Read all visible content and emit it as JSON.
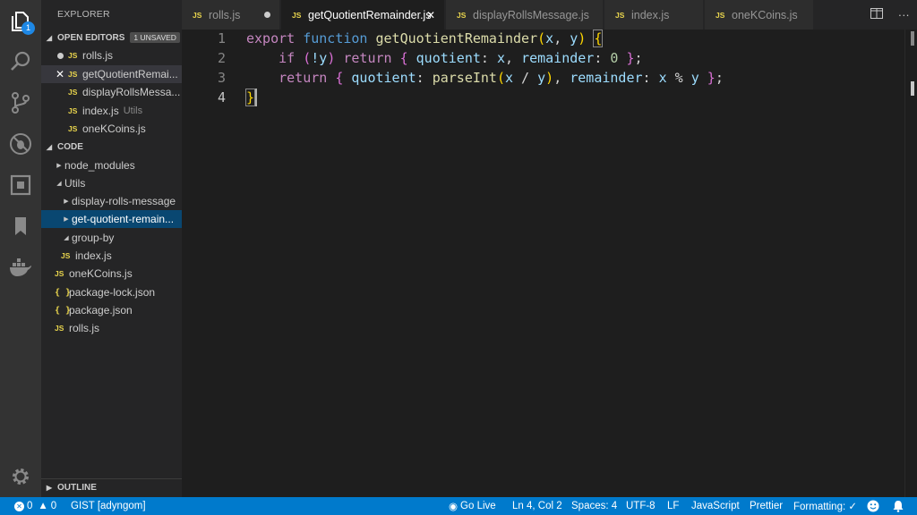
{
  "activity": {
    "badge": "1",
    "icons": [
      "files-icon",
      "search-icon",
      "source-control-icon",
      "debug-icon",
      "extensions-icon",
      "bookmark-icon",
      "docker-icon",
      "gear-icon"
    ]
  },
  "sidebar": {
    "title": "EXPLORER",
    "open_editors": {
      "label": "OPEN EDITORS",
      "badge": "1 UNSAVED",
      "items": [
        {
          "icon": "JS",
          "name": "rolls.js",
          "extra": ""
        },
        {
          "icon": "JS",
          "name": "getQuotientRemai...",
          "extra": ""
        },
        {
          "icon": "JS",
          "name": "displayRollsMessa...",
          "extra": ""
        },
        {
          "icon": "JS",
          "name": "index.js",
          "extra": "Utils"
        },
        {
          "icon": "JS",
          "name": "oneKCoins.js",
          "extra": ""
        }
      ]
    },
    "folder": {
      "label": "CODE",
      "items": [
        {
          "name": "node_modules"
        },
        {
          "name": "Utils"
        },
        {
          "name": "display-rolls-message"
        },
        {
          "name": "get-quotient-remain..."
        },
        {
          "name": "group-by"
        },
        {
          "icon": "JS",
          "name": "index.js"
        },
        {
          "icon": "JS",
          "name": "oneKCoins.js"
        },
        {
          "icon": "{ }",
          "name": "package-lock.json"
        },
        {
          "icon": "{ }",
          "name": "package.json"
        },
        {
          "icon": "JS",
          "name": "rolls.js"
        }
      ]
    },
    "outline": {
      "label": "OUTLINE"
    }
  },
  "tabs": [
    {
      "icon": "JS",
      "label": "rolls.js"
    },
    {
      "icon": "JS",
      "label": "getQuotientRemainder.js"
    },
    {
      "icon": "JS",
      "label": "displayRollsMessage.js"
    },
    {
      "icon": "JS",
      "label": "index.js"
    },
    {
      "icon": "JS",
      "label": "oneKCoins.js"
    }
  ],
  "editor": {
    "line_numbers": [
      "1",
      "2",
      "3",
      "4"
    ],
    "lines": [
      [
        {
          "t": "export",
          "c": "kw"
        },
        {
          "t": " ",
          "c": ""
        },
        {
          "t": "function",
          "c": "kw2"
        },
        {
          "t": " ",
          "c": ""
        },
        {
          "t": "getQuotientRemainder",
          "c": "fn"
        },
        {
          "t": "(",
          "c": "br"
        },
        {
          "t": "x",
          "c": "pm"
        },
        {
          "t": ", ",
          "c": ""
        },
        {
          "t": "y",
          "c": "pm"
        },
        {
          "t": ")",
          "c": "br"
        },
        {
          "t": " ",
          "c": ""
        },
        {
          "t": "{",
          "c": "br bbox"
        }
      ],
      [
        {
          "t": "    ",
          "c": ""
        },
        {
          "t": "if",
          "c": "kw"
        },
        {
          "t": " ",
          "c": ""
        },
        {
          "t": "(",
          "c": "br2"
        },
        {
          "t": "!y",
          "c": "pm"
        },
        {
          "t": ")",
          "c": "br2"
        },
        {
          "t": " ",
          "c": ""
        },
        {
          "t": "return",
          "c": "kw"
        },
        {
          "t": " ",
          "c": ""
        },
        {
          "t": "{",
          "c": "br2"
        },
        {
          "t": " ",
          "c": ""
        },
        {
          "t": "quotient",
          "c": "pm"
        },
        {
          "t": ": ",
          "c": ""
        },
        {
          "t": "x",
          "c": "pm"
        },
        {
          "t": ", ",
          "c": ""
        },
        {
          "t": "remainder",
          "c": "pm"
        },
        {
          "t": ": ",
          "c": ""
        },
        {
          "t": "0",
          "c": "num"
        },
        {
          "t": " ",
          "c": ""
        },
        {
          "t": "}",
          "c": "br2"
        },
        {
          "t": ";",
          "c": ""
        }
      ],
      [
        {
          "t": "    ",
          "c": ""
        },
        {
          "t": "return",
          "c": "kw"
        },
        {
          "t": " ",
          "c": ""
        },
        {
          "t": "{",
          "c": "br2"
        },
        {
          "t": " ",
          "c": ""
        },
        {
          "t": "quotient",
          "c": "pm"
        },
        {
          "t": ": ",
          "c": ""
        },
        {
          "t": "parseInt",
          "c": "fn"
        },
        {
          "t": "(",
          "c": "br"
        },
        {
          "t": "x",
          "c": "pm"
        },
        {
          "t": " / ",
          "c": ""
        },
        {
          "t": "y",
          "c": "pm"
        },
        {
          "t": ")",
          "c": "br"
        },
        {
          "t": ", ",
          "c": ""
        },
        {
          "t": "remainder",
          "c": "pm"
        },
        {
          "t": ": ",
          "c": ""
        },
        {
          "t": "x",
          "c": "pm"
        },
        {
          "t": " % ",
          "c": ""
        },
        {
          "t": "y",
          "c": "pm"
        },
        {
          "t": " ",
          "c": ""
        },
        {
          "t": "}",
          "c": "br2"
        },
        {
          "t": ";",
          "c": ""
        }
      ],
      [
        {
          "t": "}",
          "c": "br bbox"
        }
      ]
    ]
  },
  "status": {
    "errors": "0",
    "warnings": "0",
    "gist": "GIST [adyngom]",
    "go_live": "Go Live",
    "position": "Ln 4, Col 2",
    "spaces": "Spaces: 4",
    "encoding": "UTF-8",
    "eol": "LF",
    "language": "JavaScript",
    "prettier": "Prettier",
    "formatting": "Formatting: ✓"
  },
  "colors": {
    "status_bar": "#007acc",
    "activity_bar": "#333333",
    "sidebar": "#252526",
    "editor": "#1e1e1e",
    "selection": "#094771",
    "js_icon": "#e8d44d"
  }
}
